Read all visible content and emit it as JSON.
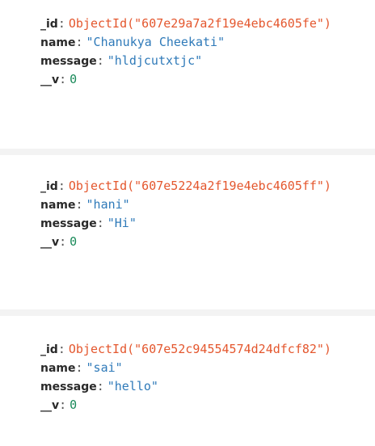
{
  "colors": {
    "key": "#2a2a2a",
    "objectid": "#e4572e",
    "string": "#2f7ab9",
    "number": "#1a8a5a",
    "divider": "#f3f3f3"
  },
  "documents": [
    {
      "id_key": "_id",
      "id_value": "ObjectId(\"607e29a7a2f19e4ebc4605fe\")",
      "name_key": "name",
      "name_value": "\"Chanukya Cheekati\"",
      "message_key": "message",
      "message_value": "\"hldjcutxtjc\"",
      "v_key": "__v",
      "v_value": "0"
    },
    {
      "id_key": "_id",
      "id_value": "ObjectId(\"607e5224a2f19e4ebc4605ff\")",
      "name_key": "name",
      "name_value": "\"hani\"",
      "message_key": "message",
      "message_value": "\"Hi\"",
      "v_key": "__v",
      "v_value": "0"
    },
    {
      "id_key": "_id",
      "id_value": "ObjectId(\"607e52c94554574d24dfcf82\")",
      "name_key": "name",
      "name_value": "\"sai\"",
      "message_key": "message",
      "message_value": "\"hello\"",
      "v_key": "__v",
      "v_value": "0"
    }
  ]
}
